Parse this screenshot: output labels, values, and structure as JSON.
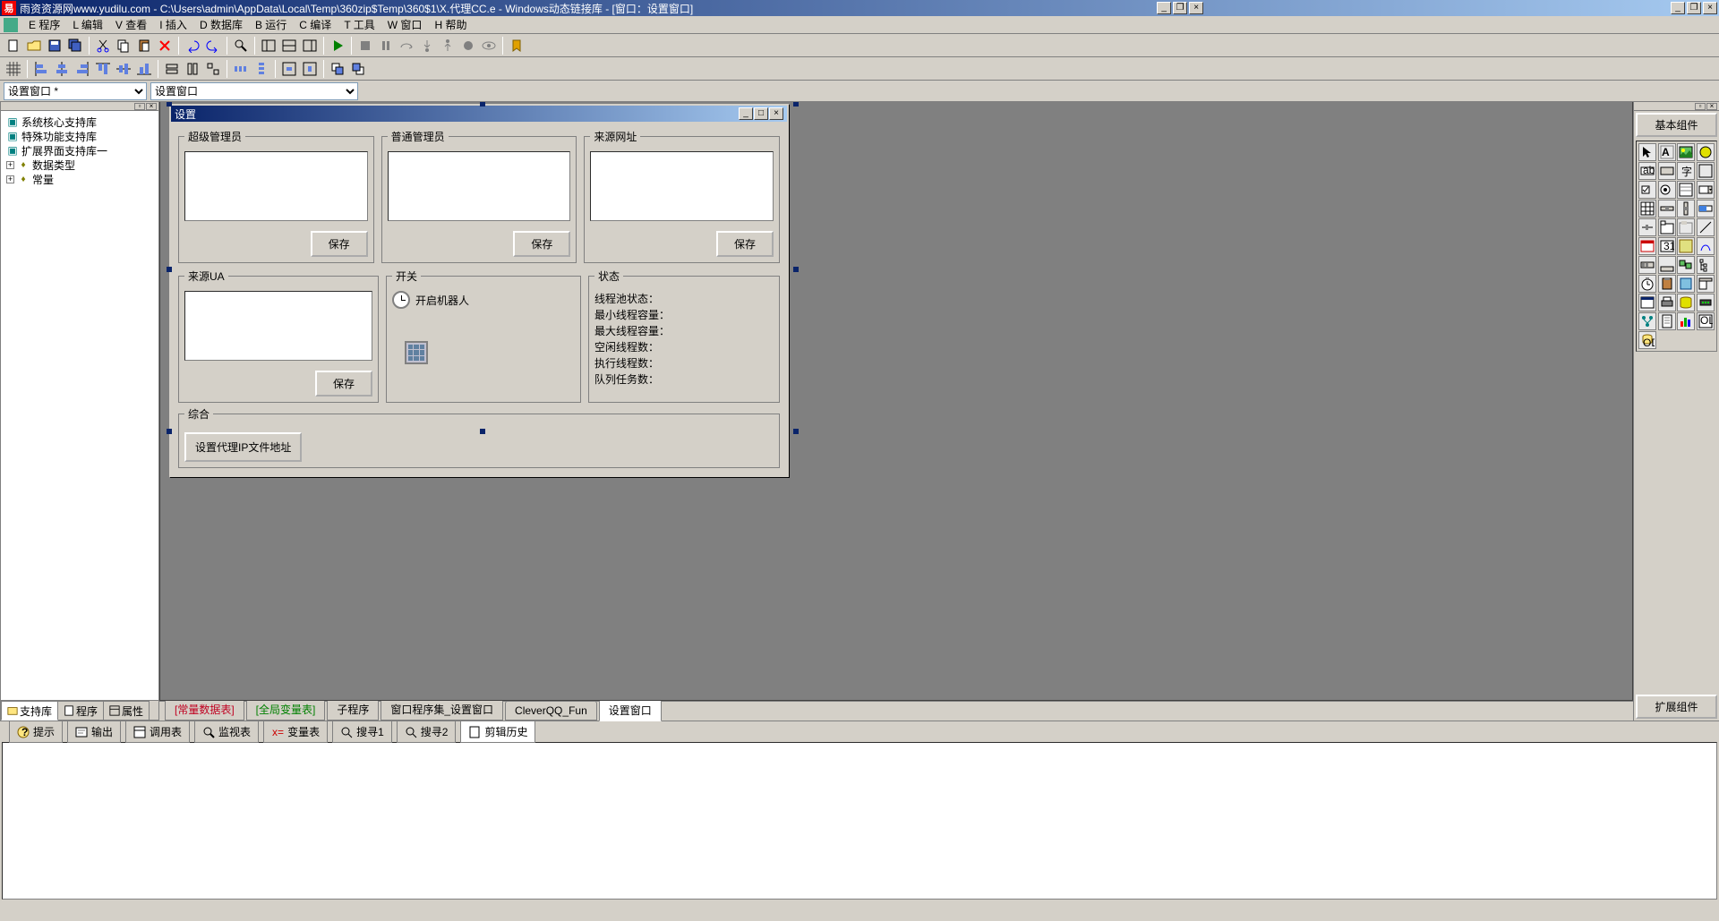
{
  "titlebar": {
    "text": "雨资资源网www.yudilu.com - C:\\Users\\admin\\AppData\\Local\\Temp\\360zip$Temp\\360$1\\X.代理CC.e - Windows动态链接库 - [窗口：设置窗口]",
    "min": "_",
    "restore": "❐",
    "close": "×",
    "min2": "_",
    "restore2": "❐",
    "close2": "×"
  },
  "menu": {
    "items": [
      "E 程序",
      "L 编辑",
      "V 查看",
      "I 插入",
      "D 数据库",
      "B 运行",
      "C 编译",
      "T 工具",
      "W 窗口",
      "H 帮助"
    ]
  },
  "combos": {
    "left": "设置窗口 *",
    "right": "设置窗口"
  },
  "tree": {
    "n0": "系统核心支持库",
    "n1": "特殊功能支持库",
    "n2": "扩展界面支持库一",
    "n3": "数据类型",
    "n4": "常量"
  },
  "leftTabs": {
    "t0": "支持库",
    "t1": "程序",
    "t2": "属性"
  },
  "form": {
    "title": "设置",
    "g1": "超级管理员",
    "g2": "普通管理员",
    "g3": "来源网址",
    "g4": "来源UA",
    "g5": "开关",
    "g6": "状态",
    "g7": "综合",
    "save": "保存",
    "switchLabel": "开启机器人",
    "status": {
      "s1": "线程池状态：",
      "s2": "最小线程容量：",
      "s3": "最大线程容量：",
      "s4": "空闲线程数：",
      "s5": "执行线程数：",
      "s6": "队列任务数："
    },
    "bigBtn": "设置代理IP文件地址"
  },
  "centerTabs": {
    "t0": "[常量数据表]",
    "t1": "[全局变量表]",
    "t2": "子程序",
    "t3": "窗口程序集_设置窗口",
    "t4": "CleverQQ_Fun",
    "t5": "设置窗口"
  },
  "rightPanel": {
    "btnTop": "基本组件",
    "btnBot": "扩展组件"
  },
  "bottomTabs": {
    "t0": "提示",
    "t1": "输出",
    "t2": "调用表",
    "t3": "监视表",
    "t4": "变量表",
    "t5": "搜寻1",
    "t6": "搜寻2",
    "t7": "剪辑历史"
  }
}
